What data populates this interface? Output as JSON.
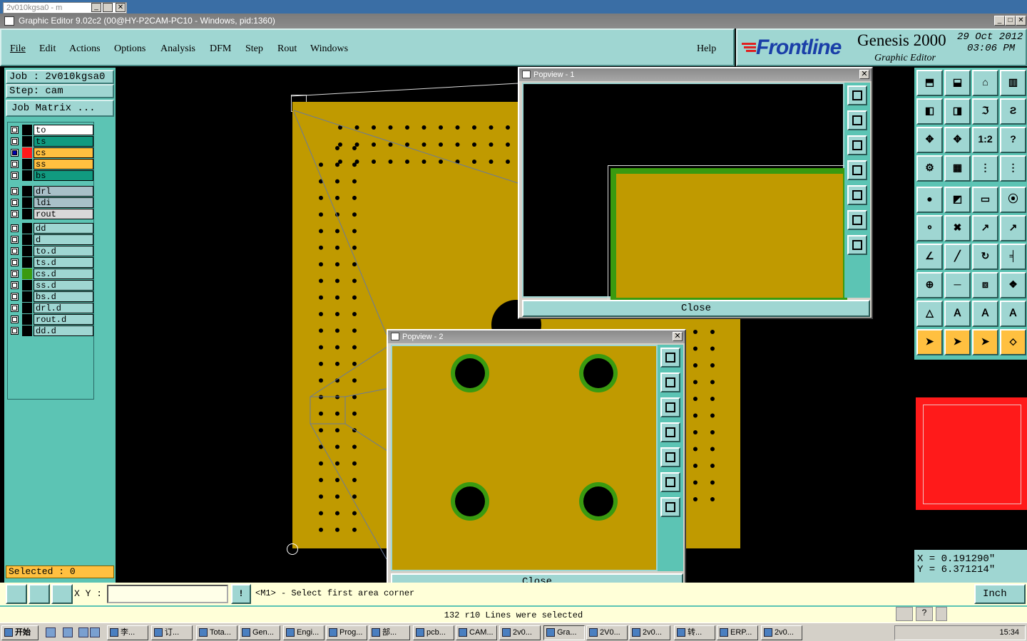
{
  "mini_window": {
    "title": "2v010kgsa0 - m"
  },
  "window": {
    "title": "Graphic Editor 9.02c2 (00@HY-P2CAM-PC10 - Windows, pid:1360)"
  },
  "menu": [
    "File",
    "Edit",
    "Actions",
    "Options",
    "Analysis",
    "DFM",
    "Step",
    "Rout",
    "Windows"
  ],
  "help_label": "Help",
  "brand": {
    "logo": "Frontline",
    "product": "Genesis 2000",
    "subtitle": "Graphic Editor",
    "date": "29 Oct 2012",
    "time": "03:06 PM"
  },
  "job": {
    "job_label": "Job : 2v010kgsa0",
    "step_label": "Step: cam",
    "matrix_button": "Job Matrix ..."
  },
  "layers_group1": [
    {
      "name": "to",
      "color": "#ffffff"
    },
    {
      "name": "ts",
      "color": "#119a80"
    },
    {
      "name": "cs",
      "color": "#ffc040",
      "active": true
    },
    {
      "name": "ss",
      "color": "#ffc040"
    },
    {
      "name": "bs",
      "color": "#119a80"
    }
  ],
  "layers_group2": [
    {
      "name": "drl",
      "color": "#a8c0c8"
    },
    {
      "name": "ldi",
      "color": "#a8c0c8"
    },
    {
      "name": "rout",
      "color": "#d8d8d8"
    }
  ],
  "layers_group3": [
    {
      "name": "dd"
    },
    {
      "name": "d"
    },
    {
      "name": "to.d"
    },
    {
      "name": "ts.d"
    },
    {
      "name": "cs.d"
    },
    {
      "name": "ss.d"
    },
    {
      "name": "bs.d"
    },
    {
      "name": "drl.d"
    },
    {
      "name": "rout.d"
    },
    {
      "name": "dd.d"
    }
  ],
  "selected_label": "Selected : 0",
  "popup1": {
    "title": "Popview - 1",
    "close": "Close"
  },
  "popup2": {
    "title": "Popview - 2",
    "close": "Close"
  },
  "coords": {
    "x": "X  =  0.191290\"",
    "y": "Y  =  6.371214\""
  },
  "command": {
    "xy_label": "X Y :",
    "xy_value": "",
    "prompt": "<M1> - Select first area corner",
    "units": "Inch"
  },
  "status": "132 r10 Lines were selected",
  "taskbar": {
    "start": "开始",
    "tasks": [
      "李...",
      "订...",
      "Tota...",
      "Gen...",
      "Engi...",
      "Prog...",
      "部...",
      "pcb...",
      "CAM...",
      "2v0...",
      "Gra...",
      "2V0...",
      "2v0...",
      "转...",
      "ERP...",
      "2v0..."
    ],
    "clock": "15:34"
  },
  "colors": {
    "teal_panel": "#5cc4b4",
    "light_teal": "#9fd6d2",
    "copper": "#c09a00",
    "pad_ring": "#3a9a10",
    "preview_red": "#ff1a1a"
  }
}
